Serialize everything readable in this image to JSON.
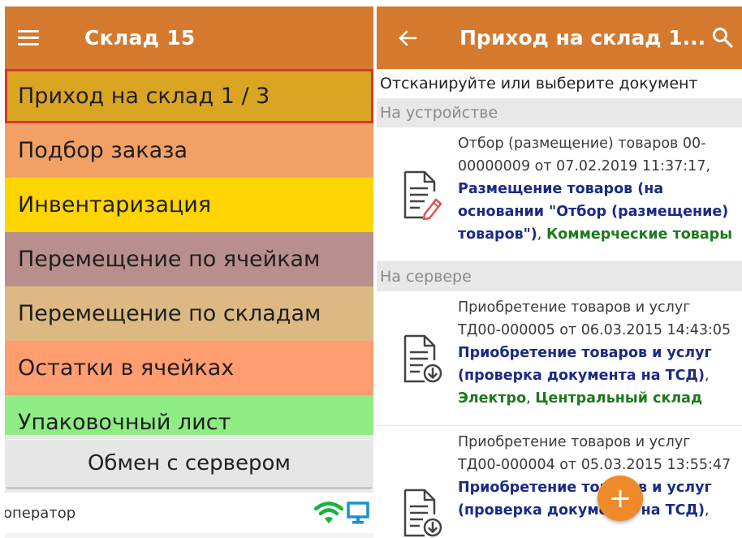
{
  "left_screen": {
    "title": "Склад 15",
    "menu": [
      {
        "label": "Приход на склад 1 / 3",
        "color": "#dba524",
        "selected": true
      },
      {
        "label": "Подбор заказа",
        "color": "#f3a067"
      },
      {
        "label": "Инвентаризация",
        "color": "#ffd500"
      },
      {
        "label": "Перемещение по ячейкам",
        "color": "#b98f8d"
      },
      {
        "label": "Перемещение по складам",
        "color": "#dcb883"
      },
      {
        "label": "Остатки в ячейках",
        "color": "#ff9d71"
      },
      {
        "label": "Упаковочный лист",
        "color": "#90ed86"
      }
    ],
    "exchange_button": "Обмен с сервером",
    "operator": "оператор",
    "status_icons": [
      "wifi-icon",
      "monitor-icon"
    ]
  },
  "right_screen": {
    "title": "Приход на склад 1...",
    "prompt": "Отсканируйте или выберите документ",
    "sections": [
      {
        "label": "На устройстве",
        "documents": [
          {
            "icon": "document-edit-icon",
            "lines": [
              "Отбор (размещение) товаров 00-",
              "00000009 от 07.02.2019 11:37:17,"
            ],
            "op_lines": [
              "Размещение товаров (на",
              "основании \"Отбор (размещение)"
            ],
            "op_tail": "товаров\")",
            "sep": ", ",
            "warehouse": "Коммерческие товары"
          }
        ]
      },
      {
        "label": "На сервере",
        "documents": [
          {
            "icon": "document-download-icon",
            "lines": [
              "Приобретение товаров и услуг",
              "ТД00-000005 от 06.03.2015 14:43:05"
            ],
            "op_lines": [
              "Приобретение товаров и услуг"
            ],
            "op_tail": "(проверка документа на ТСД)",
            "comma": ",",
            "extra_lines": [
              {
                "green": "Электро",
                "sep": ", ",
                "green2": "Центральный склад"
              }
            ]
          },
          {
            "icon": "document-download-icon",
            "lines": [
              "Приобретение товаров и услуг",
              "ТД00-000004 от 05.03.2015 13:55:47"
            ],
            "op_lines": [
              "Приобретение товаров и услуг"
            ],
            "op_tail": "(проверка документа на ТСД)",
            "comma": ","
          }
        ]
      }
    ],
    "fab_label": "+"
  }
}
